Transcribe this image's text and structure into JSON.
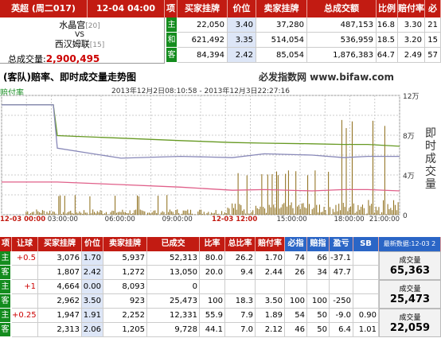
{
  "top": {
    "header": {
      "league_date": "英超 (周二017)",
      "time": "12-04 04:00",
      "cols": [
        "项",
        "买家挂牌",
        "价位",
        "卖家挂牌",
        "总成交额",
        "比例",
        "赔付率",
        "必"
      ]
    },
    "match": {
      "home": "水晶宫",
      "home_rank": "[20]",
      "vs": "VS",
      "away": "西汉姆联",
      "away_rank": "[15]",
      "volume_label": "总成交量:",
      "volume_value": "2,900,495"
    },
    "rows": [
      {
        "tag": "主",
        "buy": "22,050",
        "price": "3.40",
        "sell": "37,280",
        "total": "487,153",
        "ratio": "16.8",
        "payout": "3.30",
        "extra": "21"
      },
      {
        "tag": "和",
        "buy": "621,492",
        "price": "3.35",
        "sell": "514,054",
        "total": "536,959",
        "ratio": "18.5",
        "payout": "3.20",
        "extra": "15"
      },
      {
        "tag": "客",
        "buy": "84,394",
        "price": "2.42",
        "sell": "85,054",
        "total": "1,876,383",
        "ratio": "64.7",
        "payout": "2.49",
        "extra": "57"
      }
    ]
  },
  "chart": {
    "title": "(客队)赔率、即时成交量走势图",
    "brand": "必发指数网 www.bifaw.com",
    "legend": "赔付率",
    "range": "2013年12月2日08:10:58 - 2013年12月3日22:27:16",
    "y_title": "即时成交量",
    "y_ticks": [
      "12万",
      "8万",
      "4万",
      "0"
    ],
    "x_ticks": [
      "12-03 00:00",
      "03:00:00",
      "06:00:00",
      "09:00:00",
      "12-03 12:00",
      "15:00:00",
      "18:00:00",
      "21:00:00"
    ]
  },
  "chart_data": {
    "type": "line",
    "x": [
      "12-02 22:00",
      "12-03 00:00",
      "12-03 01:00",
      "12-03 02:00",
      "12-03 03:00",
      "12-03 06:00",
      "12-03 09:00",
      "12-03 12:00",
      "12-03 15:00",
      "12-03 18:00",
      "12-03 20:00",
      "12-03 21:00",
      "12-03 22:27"
    ],
    "series": [
      {
        "values": [
          3.15,
          3.15,
          3.15,
          3.15,
          2.66,
          2.62,
          2.58,
          2.55,
          2.54,
          2.53,
          2.52,
          2.52,
          2.49
        ],
        "color": "#669922"
      },
      {
        "values": [
          3.15,
          3.15,
          3.15,
          3.15,
          2.46,
          2.3,
          2.33,
          2.31,
          2.37,
          2.35,
          2.31,
          2.33,
          2.33
        ],
        "color": "#8888b8"
      },
      {
        "values": [
          1.92,
          1.92,
          1.92,
          1.92,
          1.92,
          1.88,
          1.84,
          1.79,
          1.8,
          1.78,
          1.8,
          1.8,
          1.78
        ],
        "color": "#e0608a"
      }
    ],
    "y_left_range": [
      1.4,
      3.3
    ],
    "y_right_range": [
      0,
      120000
    ],
    "volume_color": "#8b6a14",
    "volume_note": "即时成交量 bars (万)"
  },
  "bottom": {
    "header": [
      "项",
      "让球",
      "买家挂牌",
      "价位",
      "卖家挂牌",
      "已成交",
      "比率",
      "总比率",
      "赔付率",
      "必指",
      "赔指",
      "盈亏",
      "SB"
    ],
    "latest_label": "最新数据:12-03 2",
    "groups": [
      {
        "label": "成交量",
        "total": "65,363",
        "rows": [
          {
            "tag": "主",
            "hcp": "+0.5",
            "buy": "3,076",
            "price": "1.70",
            "sell": "5,937",
            "deal": "52,313",
            "rate": "80.0",
            "total_rate": "26.2",
            "payout": "1.70",
            "bf": "74",
            "pf": "66",
            "pl": "-37.1",
            "sb": ""
          },
          {
            "tag": "客",
            "hcp": "",
            "buy": "1,807",
            "price": "2.42",
            "sell": "1,272",
            "deal": "13,050",
            "rate": "20.0",
            "total_rate": "9.4",
            "payout": "2.44",
            "bf": "26",
            "pf": "34",
            "pl": "47.7",
            "sb": ""
          }
        ]
      },
      {
        "label": "成交量",
        "total": "25,473",
        "rows": [
          {
            "tag": "主",
            "hcp": "+1",
            "buy": "4,664",
            "price": "0.00",
            "sell": "8,093",
            "deal": "0",
            "rate": "",
            "total_rate": "",
            "payout": "",
            "bf": "",
            "pf": "",
            "pl": "",
            "sb": ""
          },
          {
            "tag": "客",
            "hcp": "",
            "buy": "2,962",
            "price": "3.50",
            "sell": "923",
            "deal": "25,473",
            "rate": "100",
            "total_rate": "18.3",
            "payout": "3.50",
            "bf": "100",
            "pf": "100",
            "pl": "-250",
            "sb": ""
          }
        ]
      },
      {
        "label": "成交量",
        "total": "22,059",
        "rows": [
          {
            "tag": "主",
            "hcp": "+0.25",
            "buy": "1,947",
            "price": "1.91",
            "sell": "2,252",
            "deal": "12,331",
            "rate": "55.9",
            "total_rate": "7.9",
            "payout": "1.89",
            "bf": "54",
            "pf": "50",
            "pl": "-9.0",
            "sb": "0.90"
          },
          {
            "tag": "客",
            "hcp": "",
            "buy": "2,313",
            "price": "2.06",
            "sell": "1,205",
            "deal": "9,728",
            "rate": "44.1",
            "total_rate": "7.0",
            "payout": "2.12",
            "bf": "46",
            "pf": "50",
            "pl": "6.4",
            "sb": "1.01"
          }
        ]
      }
    ]
  }
}
